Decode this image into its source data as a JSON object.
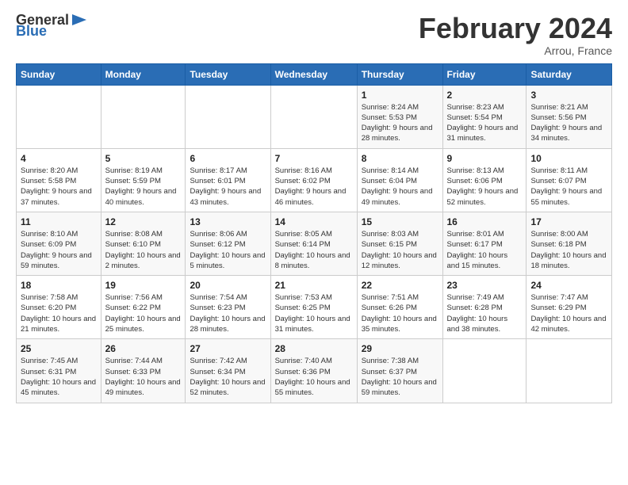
{
  "logo": {
    "text_general": "General",
    "text_blue": "Blue"
  },
  "header": {
    "month": "February 2024",
    "location": "Arrou, France"
  },
  "weekdays": [
    "Sunday",
    "Monday",
    "Tuesday",
    "Wednesday",
    "Thursday",
    "Friday",
    "Saturday"
  ],
  "weeks": [
    [
      {
        "day": "",
        "sunrise": "",
        "sunset": "",
        "daylight": ""
      },
      {
        "day": "",
        "sunrise": "",
        "sunset": "",
        "daylight": ""
      },
      {
        "day": "",
        "sunrise": "",
        "sunset": "",
        "daylight": ""
      },
      {
        "day": "",
        "sunrise": "",
        "sunset": "",
        "daylight": ""
      },
      {
        "day": "1",
        "sunrise": "Sunrise: 8:24 AM",
        "sunset": "Sunset: 5:53 PM",
        "daylight": "Daylight: 9 hours and 28 minutes."
      },
      {
        "day": "2",
        "sunrise": "Sunrise: 8:23 AM",
        "sunset": "Sunset: 5:54 PM",
        "daylight": "Daylight: 9 hours and 31 minutes."
      },
      {
        "day": "3",
        "sunrise": "Sunrise: 8:21 AM",
        "sunset": "Sunset: 5:56 PM",
        "daylight": "Daylight: 9 hours and 34 minutes."
      }
    ],
    [
      {
        "day": "4",
        "sunrise": "Sunrise: 8:20 AM",
        "sunset": "Sunset: 5:58 PM",
        "daylight": "Daylight: 9 hours and 37 minutes."
      },
      {
        "day": "5",
        "sunrise": "Sunrise: 8:19 AM",
        "sunset": "Sunset: 5:59 PM",
        "daylight": "Daylight: 9 hours and 40 minutes."
      },
      {
        "day": "6",
        "sunrise": "Sunrise: 8:17 AM",
        "sunset": "Sunset: 6:01 PM",
        "daylight": "Daylight: 9 hours and 43 minutes."
      },
      {
        "day": "7",
        "sunrise": "Sunrise: 8:16 AM",
        "sunset": "Sunset: 6:02 PM",
        "daylight": "Daylight: 9 hours and 46 minutes."
      },
      {
        "day": "8",
        "sunrise": "Sunrise: 8:14 AM",
        "sunset": "Sunset: 6:04 PM",
        "daylight": "Daylight: 9 hours and 49 minutes."
      },
      {
        "day": "9",
        "sunrise": "Sunrise: 8:13 AM",
        "sunset": "Sunset: 6:06 PM",
        "daylight": "Daylight: 9 hours and 52 minutes."
      },
      {
        "day": "10",
        "sunrise": "Sunrise: 8:11 AM",
        "sunset": "Sunset: 6:07 PM",
        "daylight": "Daylight: 9 hours and 55 minutes."
      }
    ],
    [
      {
        "day": "11",
        "sunrise": "Sunrise: 8:10 AM",
        "sunset": "Sunset: 6:09 PM",
        "daylight": "Daylight: 9 hours and 59 minutes."
      },
      {
        "day": "12",
        "sunrise": "Sunrise: 8:08 AM",
        "sunset": "Sunset: 6:10 PM",
        "daylight": "Daylight: 10 hours and 2 minutes."
      },
      {
        "day": "13",
        "sunrise": "Sunrise: 8:06 AM",
        "sunset": "Sunset: 6:12 PM",
        "daylight": "Daylight: 10 hours and 5 minutes."
      },
      {
        "day": "14",
        "sunrise": "Sunrise: 8:05 AM",
        "sunset": "Sunset: 6:14 PM",
        "daylight": "Daylight: 10 hours and 8 minutes."
      },
      {
        "day": "15",
        "sunrise": "Sunrise: 8:03 AM",
        "sunset": "Sunset: 6:15 PM",
        "daylight": "Daylight: 10 hours and 12 minutes."
      },
      {
        "day": "16",
        "sunrise": "Sunrise: 8:01 AM",
        "sunset": "Sunset: 6:17 PM",
        "daylight": "Daylight: 10 hours and 15 minutes."
      },
      {
        "day": "17",
        "sunrise": "Sunrise: 8:00 AM",
        "sunset": "Sunset: 6:18 PM",
        "daylight": "Daylight: 10 hours and 18 minutes."
      }
    ],
    [
      {
        "day": "18",
        "sunrise": "Sunrise: 7:58 AM",
        "sunset": "Sunset: 6:20 PM",
        "daylight": "Daylight: 10 hours and 21 minutes."
      },
      {
        "day": "19",
        "sunrise": "Sunrise: 7:56 AM",
        "sunset": "Sunset: 6:22 PM",
        "daylight": "Daylight: 10 hours and 25 minutes."
      },
      {
        "day": "20",
        "sunrise": "Sunrise: 7:54 AM",
        "sunset": "Sunset: 6:23 PM",
        "daylight": "Daylight: 10 hours and 28 minutes."
      },
      {
        "day": "21",
        "sunrise": "Sunrise: 7:53 AM",
        "sunset": "Sunset: 6:25 PM",
        "daylight": "Daylight: 10 hours and 31 minutes."
      },
      {
        "day": "22",
        "sunrise": "Sunrise: 7:51 AM",
        "sunset": "Sunset: 6:26 PM",
        "daylight": "Daylight: 10 hours and 35 minutes."
      },
      {
        "day": "23",
        "sunrise": "Sunrise: 7:49 AM",
        "sunset": "Sunset: 6:28 PM",
        "daylight": "Daylight: 10 hours and 38 minutes."
      },
      {
        "day": "24",
        "sunrise": "Sunrise: 7:47 AM",
        "sunset": "Sunset: 6:29 PM",
        "daylight": "Daylight: 10 hours and 42 minutes."
      }
    ],
    [
      {
        "day": "25",
        "sunrise": "Sunrise: 7:45 AM",
        "sunset": "Sunset: 6:31 PM",
        "daylight": "Daylight: 10 hours and 45 minutes."
      },
      {
        "day": "26",
        "sunrise": "Sunrise: 7:44 AM",
        "sunset": "Sunset: 6:33 PM",
        "daylight": "Daylight: 10 hours and 49 minutes."
      },
      {
        "day": "27",
        "sunrise": "Sunrise: 7:42 AM",
        "sunset": "Sunset: 6:34 PM",
        "daylight": "Daylight: 10 hours and 52 minutes."
      },
      {
        "day": "28",
        "sunrise": "Sunrise: 7:40 AM",
        "sunset": "Sunset: 6:36 PM",
        "daylight": "Daylight: 10 hours and 55 minutes."
      },
      {
        "day": "29",
        "sunrise": "Sunrise: 7:38 AM",
        "sunset": "Sunset: 6:37 PM",
        "daylight": "Daylight: 10 hours and 59 minutes."
      },
      {
        "day": "",
        "sunrise": "",
        "sunset": "",
        "daylight": ""
      },
      {
        "day": "",
        "sunrise": "",
        "sunset": "",
        "daylight": ""
      }
    ]
  ]
}
